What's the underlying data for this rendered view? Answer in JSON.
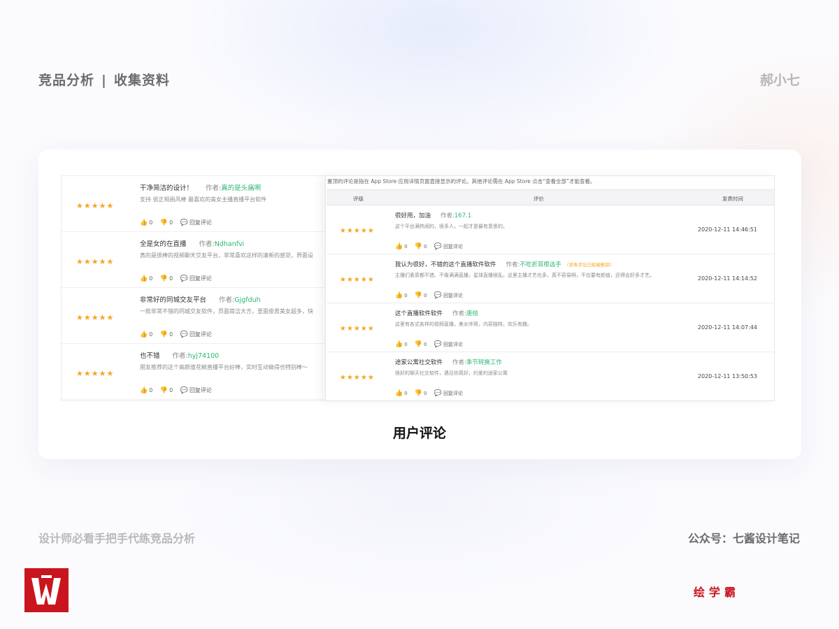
{
  "header": {
    "title": "竞品分析",
    "separator": "|",
    "subtitle": "收集资料",
    "author": "郝小七"
  },
  "left_panel": {
    "reviews": [
      {
        "stars": "★★★★★",
        "title": "干净简洁的设计！",
        "author_label": "作者:",
        "author": "真的是头痛啊",
        "body": "支持 很正规画风棒 最喜欢的美女主播直播平台软件",
        "likes": "0",
        "dislikes": "0",
        "reply": "回复评论"
      },
      {
        "stars": "★★★★★",
        "title": "全是女的在直播",
        "author_label": "作者:",
        "author": "Ndhanfvi",
        "body": "真的是很棒的视频聊天交友平台，非常喜欢这样的清新的感觉，界面设",
        "likes": "0",
        "dislikes": "0",
        "reply": "回复评论"
      },
      {
        "stars": "★★★★★",
        "title": "非常好的同城交友平台",
        "author_label": "作者:",
        "author": "Gjgfduh",
        "body": "一款非常不错的同城交友软件，页面简洁大方，里面俊男美女超多，快",
        "likes": "0",
        "dislikes": "0",
        "reply": "回复评论"
      },
      {
        "stars": "★★★★★",
        "title": "也不错",
        "author_label": "作者:",
        "author": "hyj74100",
        "body": "朋友推荐的这个高颜值花椒直播平台好棒，实时互动做得也特别棒～",
        "likes": "0",
        "dislikes": "0",
        "reply": "回复评论"
      }
    ]
  },
  "right_panel": {
    "notice": "置顶的评论是指在 App Store 应用详情页面直接显示的评论。其他评论需在 App Store 点击“查看全部”才能查看。",
    "columns": {
      "rating": "评级",
      "review": "评价",
      "time": "发表时间"
    },
    "reviews": [
      {
        "stars": "★★★★★",
        "title": "很好用，加油",
        "author_label": "作者:",
        "author": "167.1",
        "tag": "",
        "body": "这个平台满热闹的，很多人，一起才是最有意思的。",
        "likes": "0",
        "dislikes": "0",
        "reply": "回复评论",
        "time": "2020-12-11 14:46:51"
      },
      {
        "stars": "★★★★★",
        "title": "我认为很好，不错的这个直播软件软件",
        "author_label": "作者:",
        "author": "不吃折耳根选手",
        "tag": "(该条评论已经被删除)",
        "body": "主播们素质都不错、不像满满直播，星球直播很乱。这里主播才艺也多，真不容易啊，不仅要有颜值，还得会好多才艺。",
        "likes": "0",
        "dislikes": "0",
        "reply": "回复评论",
        "time": "2020-12-11 14:14:52"
      },
      {
        "stars": "★★★★★",
        "title": "这个直播软件软件",
        "author_label": "作者:",
        "author": "唐结",
        "tag": "",
        "body": "这里有各式各样的视频直播，美女帅哥，内容独特，欢乐有趣。",
        "likes": "0",
        "dislikes": "0",
        "reply": "回复评论",
        "time": "2020-12-11 14:07:44"
      },
      {
        "stars": "★★★★★",
        "title": "途家公寓社交软件",
        "author_label": "作者:",
        "author": "季节转换工作",
        "tag": "",
        "body": "很好的聊天社交软件，遇见你真好，约爱的途家公寓",
        "likes": "0",
        "dislikes": "0",
        "reply": "回复评论",
        "time": "2020-12-11 13:50:53"
      }
    ]
  },
  "caption": "用户评论",
  "footer": {
    "left": "设计师必看手把手代练竞品分析",
    "right": "公众号：七酱设计笔记"
  },
  "brand": "绘学霸",
  "colors": {
    "accent_green": "#2bb673",
    "star": "#f5a623",
    "brand_red": "#c9151e"
  }
}
